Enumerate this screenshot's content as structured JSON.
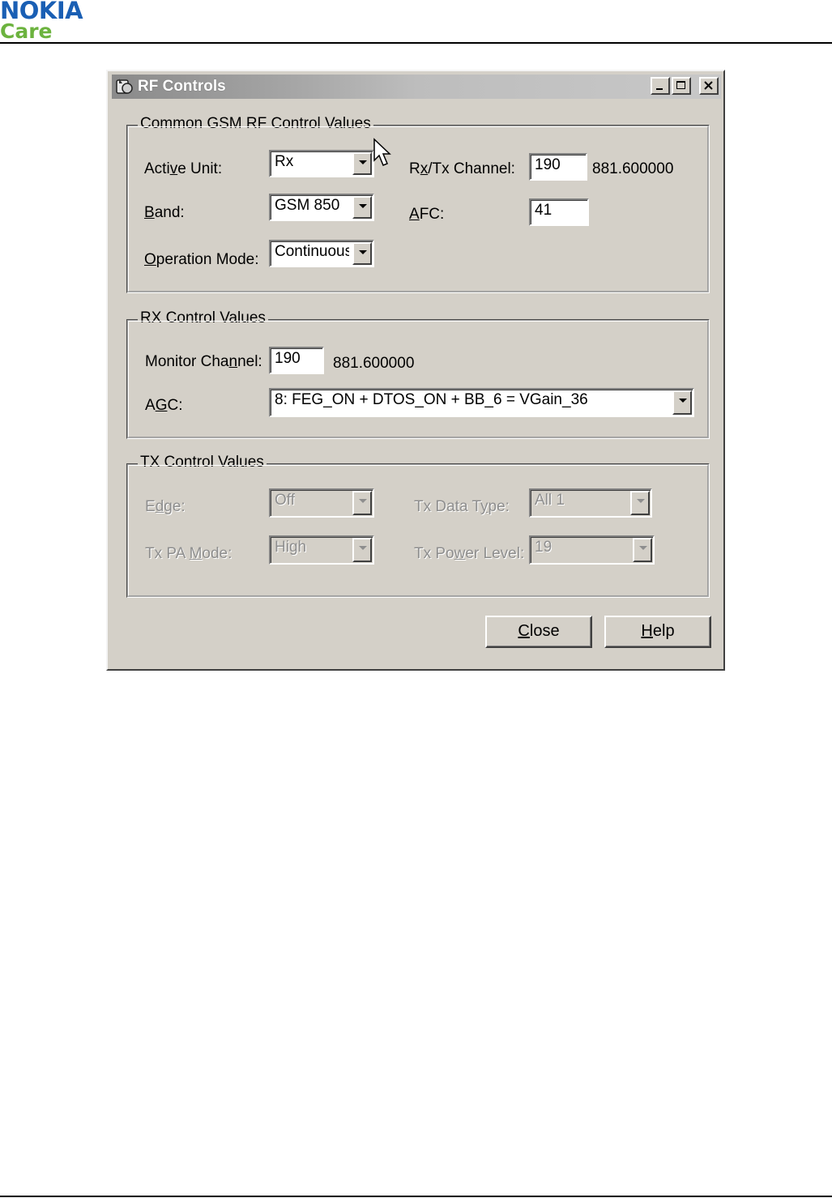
{
  "header": {
    "brand": "NOKIA",
    "sub": "Care"
  },
  "window": {
    "title": "RF Controls"
  },
  "common": {
    "legend": "Common GSM RF Control Values",
    "active_unit": {
      "label_pre": "Acti",
      "label_u": "v",
      "label_post": "e Unit:",
      "value": "Rx"
    },
    "band": {
      "label_u": "B",
      "label_post": "and:",
      "value": "GSM 850"
    },
    "operation_mode": {
      "label_u": "O",
      "label_post": "peration Mode:",
      "value": "Continuous"
    },
    "rxtx_channel": {
      "label_pre": "R",
      "label_u": "x",
      "label_post": "/Tx Channel:",
      "value": "190",
      "freq": "881.600000"
    },
    "afc": {
      "label_u": "A",
      "label_post": "FC:",
      "value": "41"
    }
  },
  "rx": {
    "legend": "RX Control Values",
    "monitor_channel": {
      "label_pre": "Monitor Cha",
      "label_u": "n",
      "label_post": "nel:",
      "value": "190",
      "freq": "881.600000"
    },
    "agc": {
      "label_pre": "A",
      "label_u": "G",
      "label_post": "C:",
      "value": "8: FEG_ON + DTOS_ON + BB_6 = VGain_36"
    }
  },
  "tx": {
    "legend": "TX Control Values",
    "edge": {
      "label_pre": "E",
      "label_u": "d",
      "label_post": "ge:",
      "value": "Off"
    },
    "tx_pa_mode": {
      "label_pre": "Tx PA ",
      "label_u": "M",
      "label_post": "ode:",
      "value": "High"
    },
    "tx_data_type": {
      "label_pre": "Tx Data T",
      "label_u": "y",
      "label_post": "pe:",
      "value": "All 1"
    },
    "tx_power_level": {
      "label_pre": "Tx Po",
      "label_u": "w",
      "label_post": "er Level:",
      "value": "19"
    }
  },
  "buttons": {
    "close": {
      "u": "C",
      "rest": "lose"
    },
    "help": {
      "u": "H",
      "rest": "elp"
    }
  }
}
